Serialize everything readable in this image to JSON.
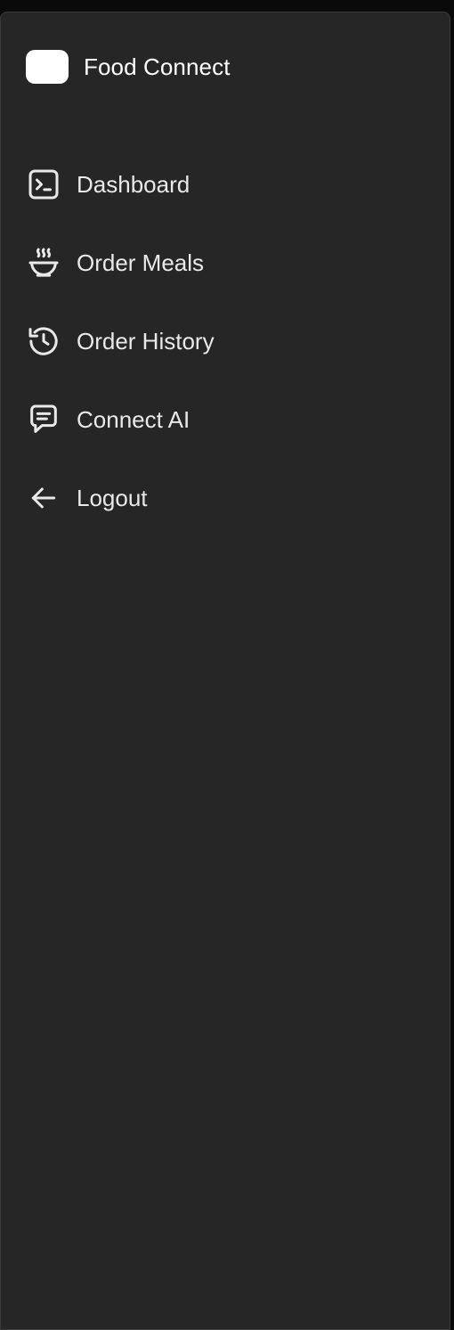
{
  "brand": {
    "name": "Food Connect"
  },
  "nav": {
    "items": [
      {
        "label": "Dashboard",
        "icon": "terminal-square-icon"
      },
      {
        "label": "Order Meals",
        "icon": "soup-bowl-icon"
      },
      {
        "label": "Order History",
        "icon": "history-icon"
      },
      {
        "label": "Connect AI",
        "icon": "message-square-text-icon"
      },
      {
        "label": "Logout",
        "icon": "arrow-left-icon"
      }
    ]
  },
  "colors": {
    "background": "#0a0a0b",
    "sidebar": "#262626",
    "text": "#e9e9e9",
    "brand_text": "#ffffff"
  }
}
